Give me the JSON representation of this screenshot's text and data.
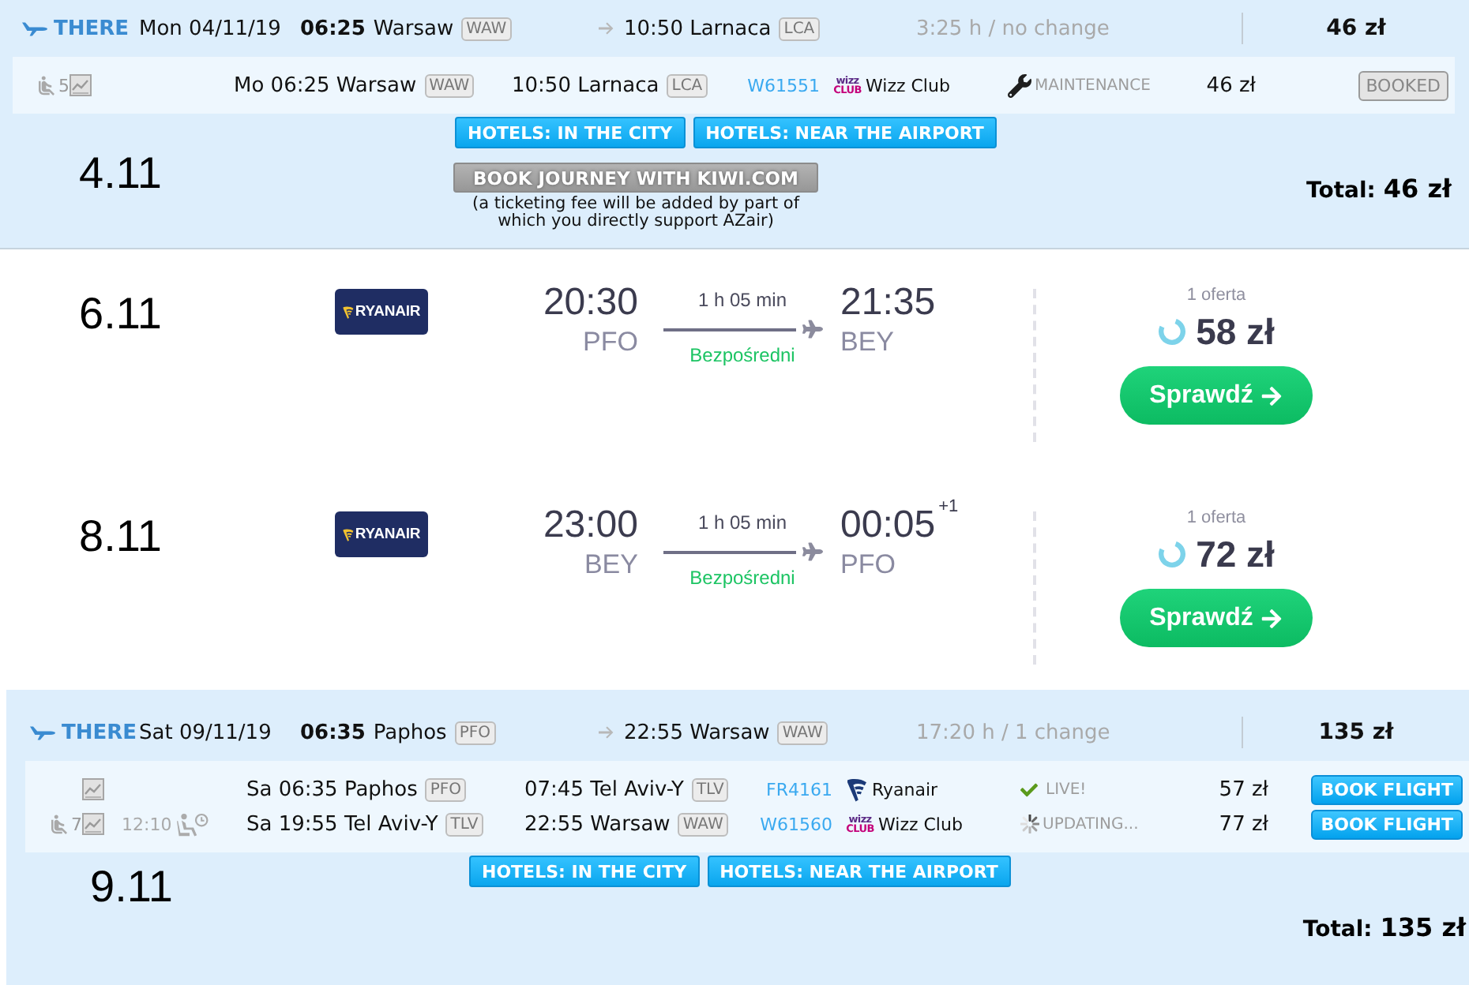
{
  "first_trip": {
    "header": {
      "direction": "THERE",
      "date": "Mon 04/11/19",
      "depart_time": "06:25",
      "from_city": "Warsaw",
      "from_code": "WAW",
      "arrival": "10:50 Larnaca",
      "to_code": "LCA",
      "duration": "3:25 h / no change",
      "price": "46 zł"
    },
    "segments": [
      {
        "seats": "5",
        "departure": "Mo 06:25 Warsaw",
        "from_code": "WAW",
        "arrival": "10:50 Larnaca",
        "to_code": "LCA",
        "flight_no": "W61551",
        "airline": {
          "kind": "wizz",
          "logo_text": [
            "wizz",
            "CLUB"
          ],
          "name": "Wizz Club"
        },
        "status": {
          "kind": "maintenance",
          "label": "MAINTENANCE"
        },
        "price": "46 zł",
        "action": {
          "kind": "booked",
          "label": "BOOKED"
        }
      }
    ],
    "hotels": [
      "HOTELS: IN THE CITY",
      "HOTELS: NEAR THE AIRPORT"
    ],
    "date_label": "4.11",
    "kiwi_button": "BOOK JOURNEY WITH KIWI.COM",
    "fee_note": "(a ticketing fee will be added by part of which you directly support AZair)",
    "total": {
      "label": "Total:",
      "amount": "46 zł"
    }
  },
  "flight_offers": [
    {
      "date": "6.11",
      "airline": {
        "kind": "ryanair",
        "logo_text": "RYANAIR"
      },
      "depart_time": "20:30",
      "from": "PFO",
      "duration": "1 h 05 min",
      "stops": "Bezpośredni",
      "arrive_time": "21:35",
      "to": "BEY",
      "offer_count": "1 oferta",
      "price": "58 zł",
      "button": "Sprawdź"
    },
    {
      "date": "8.11",
      "airline": {
        "kind": "ryanair",
        "logo_text": "RYANAIR"
      },
      "depart_time": "23:00",
      "from": "BEY",
      "duration": "1 h 05 min",
      "stops": "Bezpośredni",
      "arrive_time": "00:05",
      "day_offset": "+1",
      "to": "PFO",
      "offer_count": "1 oferta",
      "price": "72 zł",
      "button": "Sprawdź"
    }
  ],
  "second_trip": {
    "header": {
      "direction": "THERE",
      "date": "Sat 09/11/19",
      "depart_time": "06:35",
      "from_city": "Paphos",
      "from_code": "PFO",
      "arrival": "22:55 Warsaw",
      "to_code": "WAW",
      "duration": "17:20 h / 1 change",
      "price": "135 zł"
    },
    "segments": [
      {
        "departure": "Sa 06:35 Paphos",
        "from_code": "PFO",
        "arrival": "07:45 Tel Aviv-Y",
        "to_code": "TLV",
        "flight_no": "FR4161",
        "airline": {
          "kind": "ryanair",
          "name": "Ryanair"
        },
        "status": {
          "kind": "live",
          "label": "LIVE!"
        },
        "price": "57 zł",
        "action": {
          "kind": "book",
          "label": "BOOK FLIGHT"
        }
      },
      {
        "seats": "7",
        "layover": "12:10",
        "departure": "Sa 19:55 Tel Aviv-Y",
        "from_code": "TLV",
        "arrival": "22:55 Warsaw",
        "to_code": "WAW",
        "flight_no": "W61560",
        "airline": {
          "kind": "wizz",
          "logo_text": [
            "wizz",
            "CLUB"
          ],
          "name": "Wizz Club"
        },
        "status": {
          "kind": "updating",
          "label": "UPDATING..."
        },
        "price": "77 zł",
        "action": {
          "kind": "book",
          "label": "BOOK FLIGHT"
        }
      }
    ],
    "hotels": [
      "HOTELS: IN THE CITY",
      "HOTELS: NEAR THE AIRPORT"
    ],
    "date_label": "9.11",
    "total": {
      "label": "Total:",
      "amount": "135 zł"
    }
  }
}
